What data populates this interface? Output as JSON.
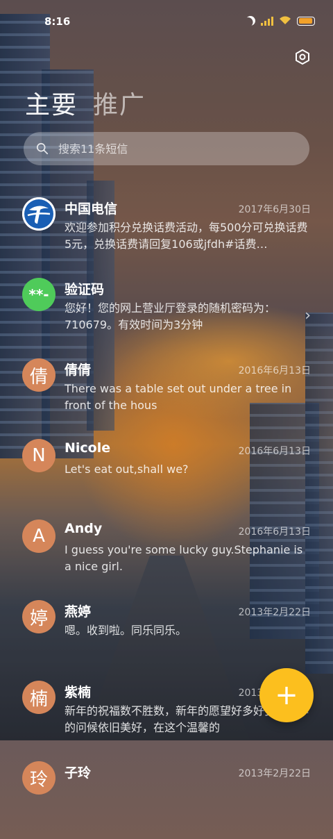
{
  "status_bar": {
    "time": "8:16",
    "icons": [
      "moon-icon",
      "signal-icon",
      "wifi-icon",
      "battery-icon"
    ],
    "accent": "#f0c040"
  },
  "header": {
    "tabs": [
      {
        "label": "主要",
        "active": true
      },
      {
        "label": "推广",
        "active": false
      }
    ],
    "settings_icon": "gear-icon"
  },
  "search": {
    "placeholder": "搜索11条短信",
    "icon": "search-icon"
  },
  "conversations": [
    {
      "avatar": "",
      "avatar_type": "china-telecom-logo",
      "name": "中国电信",
      "date": "2017年6月30日",
      "preview": "欢迎参加积分兑换话费活动，每500分可兑换话费5元，兑换话费请回复106或jfdh#话费…"
    },
    {
      "avatar": "**-",
      "avatar_type": "green",
      "name": "验证码",
      "date": "",
      "preview": "您好！您的网上营业厅登录的随机密码为：710679。有效时间为3分钟",
      "has_chevron": true
    },
    {
      "avatar": "倩",
      "avatar_type": "orange",
      "name": "倩倩",
      "date": "2016年6月13日",
      "preview": "There was a table set out under a tree in front of the hous"
    },
    {
      "avatar": "N",
      "avatar_type": "orange",
      "name": "Nicole",
      "date": "2016年6月13日",
      "preview": "Let's eat out,shall we?"
    },
    {
      "avatar": "A",
      "avatar_type": "orange",
      "name": "Andy",
      "date": "2016年6月13日",
      "preview": "I guess you're some lucky guy.Stephanie is a nice girl."
    },
    {
      "avatar": "婷",
      "avatar_type": "orange",
      "name": "燕婷",
      "date": "2013年2月22日",
      "preview": "嗯。收到啦。同乐同乐。"
    },
    {
      "avatar": "楠",
      "avatar_type": "orange",
      "name": "紫楠",
      "date": "2013年2月22日",
      "preview": "新年的祝福数不胜数，新年的愿望好多好多，新年的问候依旧美好，在这个温馨的"
    },
    {
      "avatar": "玲",
      "avatar_type": "orange",
      "name": "子玲",
      "date": "2013年2月22日",
      "preview": ""
    }
  ],
  "fab": {
    "label": "+",
    "icon": "plus-icon",
    "color": "#fcbf1e"
  }
}
